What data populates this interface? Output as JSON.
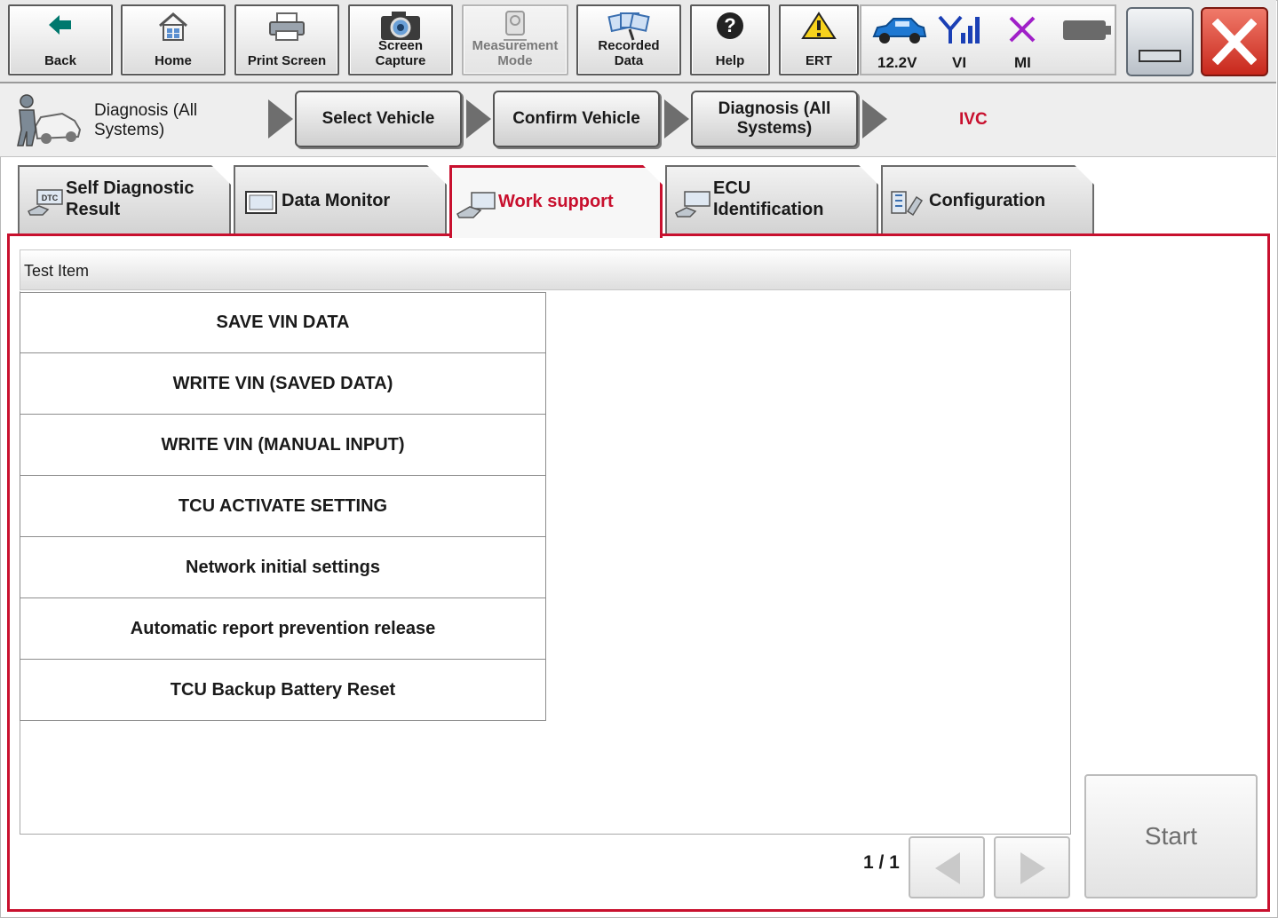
{
  "toolbar": {
    "back": "Back",
    "home": "Home",
    "print": "Print Screen",
    "capture_1": "Screen",
    "capture_2": "Capture",
    "measure_1": "Measurement",
    "measure_2": "Mode",
    "recorded_1": "Recorded",
    "recorded_2": "Data",
    "help": "Help",
    "ert": "ERT"
  },
  "status": {
    "voltage": "12.2V",
    "vi": "VI",
    "mi": "MI"
  },
  "breadcrumb": {
    "title_1": "Diagnosis (All",
    "title_2": "Systems)",
    "step1": "Select Vehicle",
    "step2": "Confirm Vehicle",
    "step3_1": "Diagnosis (All",
    "step3_2": "Systems)",
    "current": "IVC"
  },
  "tabs": {
    "self_diag_1": "Self Diagnostic",
    "self_diag_2": "Result",
    "data_monitor": "Data Monitor",
    "work_support": "Work support",
    "ecu_1": "ECU",
    "ecu_2": "Identification",
    "configuration": "Configuration",
    "dtc_badge": "DTC"
  },
  "table": {
    "header": "Test Item",
    "items": [
      "SAVE VIN DATA",
      "WRITE VIN (SAVED DATA)",
      "WRITE VIN (MANUAL INPUT)",
      "TCU ACTIVATE SETTING",
      "Network initial settings",
      "Automatic report prevention release",
      "TCU Backup Battery Reset"
    ]
  },
  "pager": {
    "text": "1 / 1"
  },
  "start": "Start",
  "colors": {
    "accent": "#c8102e",
    "teal": "#00786e",
    "signal": "#1a3fb5",
    "mi": "#a020c8",
    "car": "#1e78d2"
  }
}
